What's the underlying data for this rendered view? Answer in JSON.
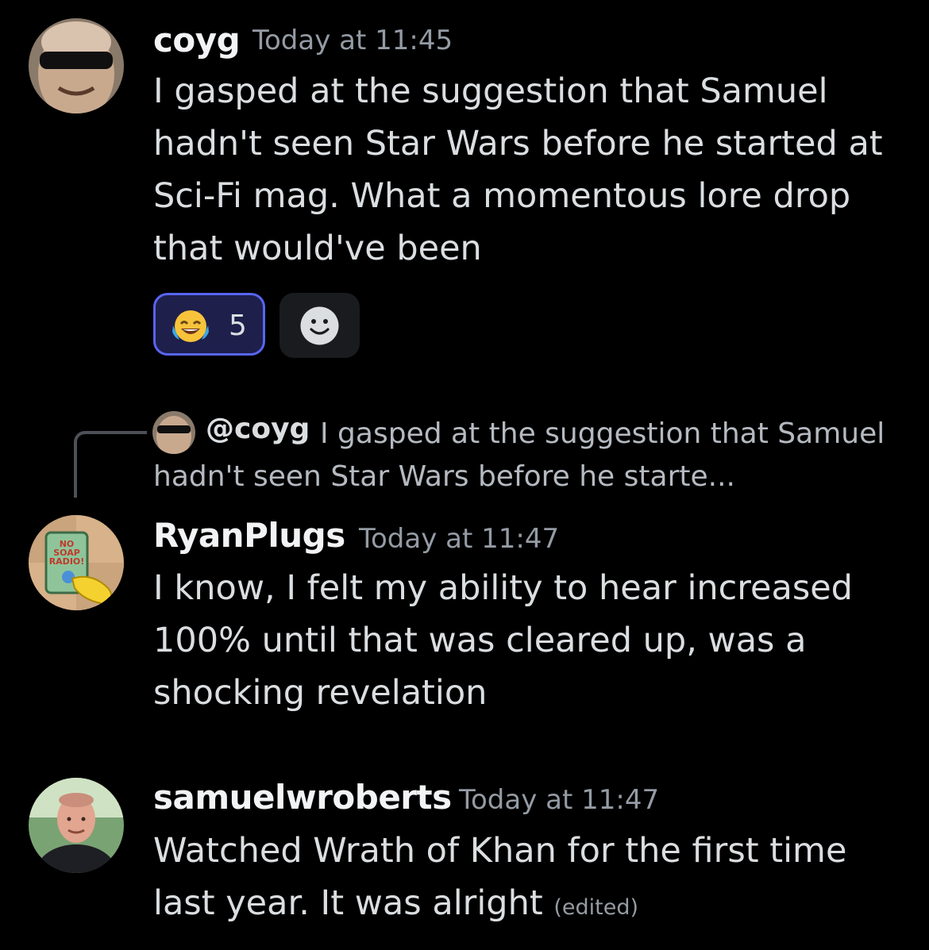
{
  "messages": [
    {
      "username": "coyg",
      "timestamp": "Today at 11:45",
      "text": "I gasped at the suggestion that Samuel hadn't seen Star Wars before he started at Sci-Fi mag. What a momentous lore drop that would've been",
      "reaction": {
        "emoji_icon": "joy-emoji-icon",
        "count": "5"
      }
    },
    {
      "reply": {
        "mention": "@coyg",
        "text": "I gasped at the suggestion that Samuel hadn't seen Star Wars before he starte..."
      },
      "username": "RyanPlugs",
      "timestamp": "Today at 11:47",
      "text": "I know, I felt my ability to hear increased 100% until that was cleared up, was a shocking revelation"
    },
    {
      "username": "samuelwroberts",
      "timestamp": "Today at 11:47",
      "text": "Watched Wrath of Khan for the first time last year. It was alright",
      "edited": "(edited)"
    }
  ],
  "colors": {
    "background": "#000000",
    "username": "#f2f3f5",
    "text": "#dbdee1",
    "muted": "#949ba4",
    "reaction_border": "#5865f2"
  }
}
